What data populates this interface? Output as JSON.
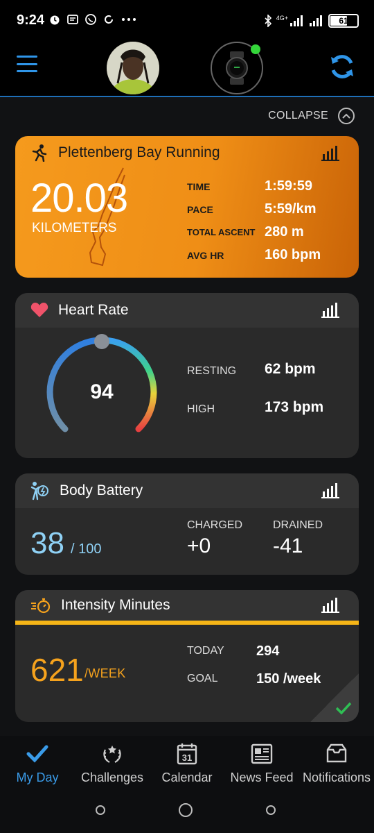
{
  "status_bar": {
    "time": "9:24",
    "network": "4G+",
    "battery": "61"
  },
  "header": {
    "menu_icon": "hamburger-menu-icon",
    "avatar": "user-avatar",
    "device": "watch-device-icon",
    "sync_icon": "sync-icon"
  },
  "collapse_label": "COLLAPSE",
  "run": {
    "title": "Plettenberg Bay Running",
    "distance": "20.03",
    "unit": "KILOMETERS",
    "stats": [
      {
        "label": "TIME",
        "value": "1:59:59"
      },
      {
        "label": "PACE",
        "value": "5:59/km"
      },
      {
        "label": "TOTAL ASCENT",
        "value": "280 m"
      },
      {
        "label": "AVG HR",
        "value": "160 bpm"
      }
    ],
    "color": "#f59a1d"
  },
  "heart_rate": {
    "title": "Heart Rate",
    "value": "94",
    "stats": [
      {
        "label": "RESTING",
        "value": "62 bpm"
      },
      {
        "label": "HIGH",
        "value": "173 bpm"
      }
    ],
    "heart_color": "#f0536a"
  },
  "body_battery": {
    "title": "Body Battery",
    "value": "38",
    "max": "/ 100",
    "charged_label": "CHARGED",
    "charged_value": "+0",
    "drained_label": "DRAINED",
    "drained_value": "-41",
    "color": "#8fd1f5"
  },
  "intensity": {
    "title": "Intensity Minutes",
    "value": "621",
    "unit": "/WEEK",
    "stats": [
      {
        "label": "TODAY",
        "value": "294"
      },
      {
        "label": "GOAL",
        "value": "150 /week"
      }
    ],
    "color": "#f5a21d"
  },
  "nav": [
    {
      "label": "My Day",
      "icon": "checkmark-icon",
      "active": true
    },
    {
      "label": "Challenges",
      "icon": "laurel-icon",
      "active": false
    },
    {
      "label": "Calendar",
      "icon": "calendar-icon",
      "active": false,
      "calendar_day": "31"
    },
    {
      "label": "News Feed",
      "icon": "newspaper-icon",
      "active": false
    },
    {
      "label": "Notifications",
      "icon": "inbox-icon",
      "active": false
    }
  ]
}
